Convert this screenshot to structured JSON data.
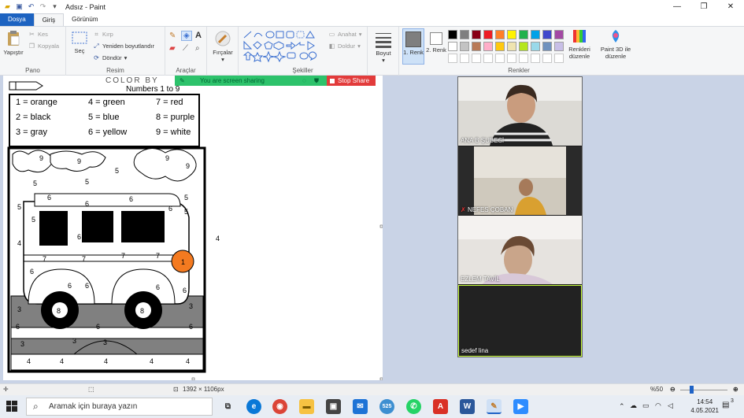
{
  "window": {
    "title": "Adsız - Paint",
    "controls": {
      "minimize": "—",
      "maximize": "❐",
      "close": "✕"
    }
  },
  "tabs": [
    "Dosya",
    "Giriş",
    "Görünüm"
  ],
  "ribbon": {
    "clipboard": {
      "paste": "Yapıştır",
      "cut": "Kes",
      "copy": "Kopyala",
      "label": "Pano"
    },
    "image": {
      "select": "Seç",
      "crop": "Kırp",
      "resize": "Yeniden boyutlandır",
      "rotate": "Döndür",
      "label": "Resim"
    },
    "tools": {
      "label": "Araçlar"
    },
    "brushes": {
      "label": "Fırçalar"
    },
    "shapes": {
      "outline": "Anahat",
      "fill": "Doldur",
      "label": "Şekiller"
    },
    "size": {
      "label": "Boyut"
    },
    "colors": {
      "color1": "1. Renk",
      "color2": "2. Renk",
      "edit": "Renkleri düzenle",
      "paint3d": "Paint 3D ile düzenle",
      "label": "Renkler",
      "palette_row1": [
        "#000000",
        "#7f7f7f",
        "#880015",
        "#ed1c24",
        "#ff7f27",
        "#fff200",
        "#22b14c",
        "#00a2e8",
        "#3f48cc",
        "#a349a4"
      ],
      "palette_row2": [
        "#ffffff",
        "#c3c3c3",
        "#b97a57",
        "#ffaec9",
        "#ffc90e",
        "#efe4b0",
        "#b5e61d",
        "#99d9ea",
        "#7092be",
        "#c8bfe7"
      ]
    }
  },
  "sharing": {
    "banner": "You are screen sharing",
    "stop": "Stop Share"
  },
  "worksheet": {
    "heading": "COLOR BY",
    "subheading": "Numbers 1 to 9",
    "legend": [
      [
        "1 = orange",
        "4 = green",
        "7 = red"
      ],
      [
        "2 = black",
        "5 = blue",
        "8 = purple"
      ],
      [
        "3 = gray",
        "6 = yellow",
        "9 = white"
      ]
    ]
  },
  "participants": [
    {
      "name": "ANA B ŞUBESİ",
      "muted": false
    },
    {
      "name": "NEFES ÇOBAN",
      "muted": true
    },
    {
      "name": "EZLEM TAVİL",
      "muted": false
    },
    {
      "name": "sedef lina",
      "muted": false
    }
  ],
  "status": {
    "dimensions": "1392 × 1106px",
    "zoom": "%50",
    "zoom_level": 0.5
  },
  "taskbar": {
    "search_placeholder": "Aramak için buraya yazın",
    "time": "14:54",
    "date": "4.05.2021",
    "notifications": "3"
  }
}
